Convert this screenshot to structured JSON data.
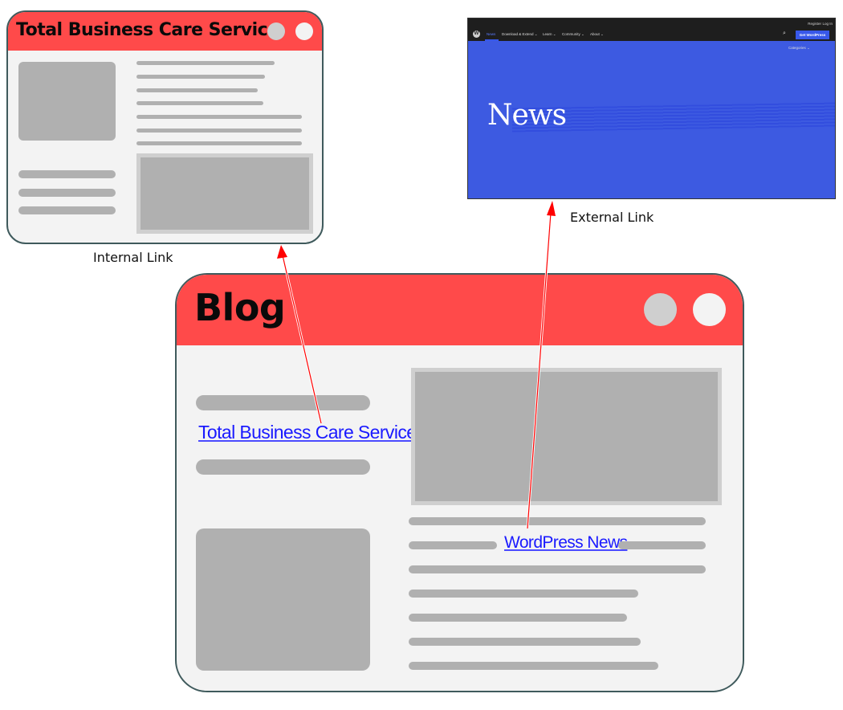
{
  "internal_window": {
    "title": "Total Business Care Service",
    "caption": "Internal Link"
  },
  "external_window": {
    "caption": "External Link",
    "site": {
      "top_links": [
        "Register",
        "Log In"
      ],
      "nav": [
        "News",
        "Download & Extend ⌄",
        "Learn ⌄",
        "Community ⌄",
        "About ⌄"
      ],
      "active_nav": "News",
      "logo_glyph": "W",
      "search_icon_glyph": "⌕",
      "cta_label": "Get WordPress",
      "categories_label": "Categories ⌄",
      "heading": "News"
    }
  },
  "blog_window": {
    "title": "Blog",
    "internal_link_text": "Total Business Care Service",
    "external_link_text": "WordPress News"
  },
  "colors": {
    "title_bar": "#ff4a4a",
    "window_body": "#f3f3f3",
    "placeholder": "#b0b0b0",
    "link": "#1a1aff",
    "arrow": "#ff0000",
    "wp_blue": "#3d5ae1",
    "wp_dark": "#1e1e1e"
  }
}
